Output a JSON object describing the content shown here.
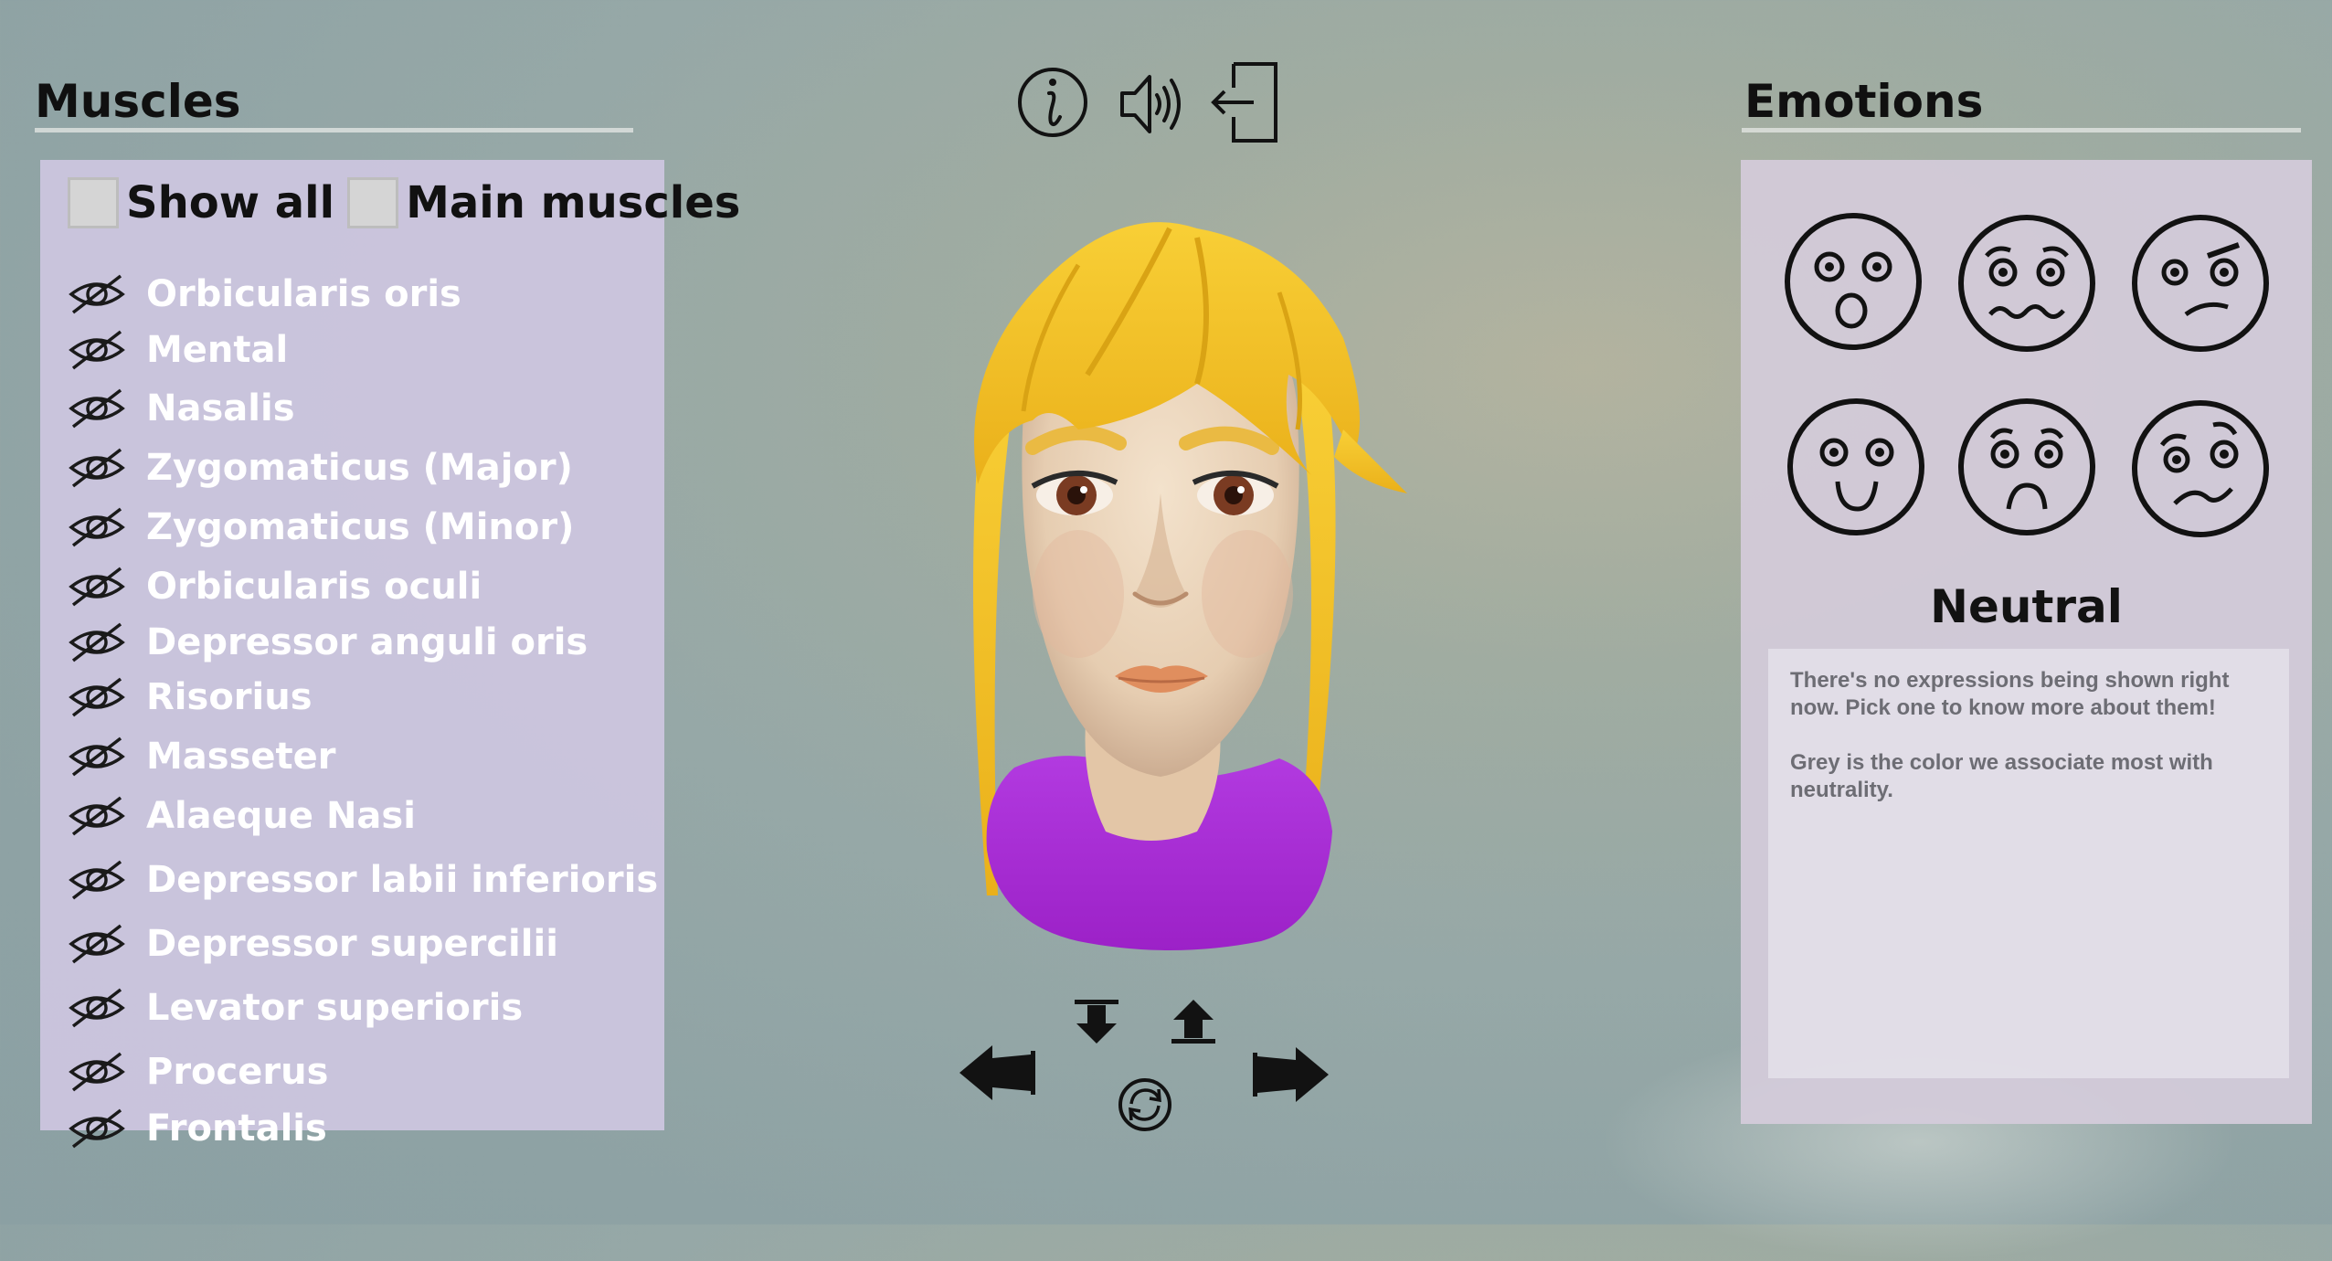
{
  "muscles": {
    "title": "Muscles",
    "show_all_label": "Show all",
    "main_muscles_label": "Main muscles",
    "items": [
      {
        "label": "Orbicularis oris"
      },
      {
        "label": "Mental"
      },
      {
        "label": "Nasalis"
      },
      {
        "label": "Zygomaticus (Major)"
      },
      {
        "label": "Zygomaticus (Minor)"
      },
      {
        "label": "Orbicularis oculi"
      },
      {
        "label": "Depressor anguli oris"
      },
      {
        "label": "Risorius"
      },
      {
        "label": "Masseter"
      },
      {
        "label": "Alaeque Nasi"
      },
      {
        "label": "Depressor labii inferioris"
      },
      {
        "label": "Depressor supercilii"
      },
      {
        "label": "Levator superioris"
      },
      {
        "label": "Procerus"
      },
      {
        "label": "Frontalis"
      }
    ]
  },
  "toolbar": {
    "info_icon": "info-icon",
    "sound_icon": "speaker-icon",
    "exit_icon": "exit-icon"
  },
  "emotions": {
    "title": "Emotions",
    "faces": [
      {
        "icon": "surprised-face-icon"
      },
      {
        "icon": "fearful-face-icon"
      },
      {
        "icon": "angry-face-icon"
      },
      {
        "icon": "happy-face-icon"
      },
      {
        "icon": "sad-face-icon"
      },
      {
        "icon": "disgusted-face-icon"
      }
    ],
    "selected": "Neutral",
    "description_1": "There's no expressions being shown right now. Pick one to know more about them!",
    "description_2": "Grey is the color we associate most with neutrality."
  },
  "colors": {
    "hair": "#f2bf1e",
    "shirt": "#a92fd6",
    "skin": "#eed7bd"
  }
}
